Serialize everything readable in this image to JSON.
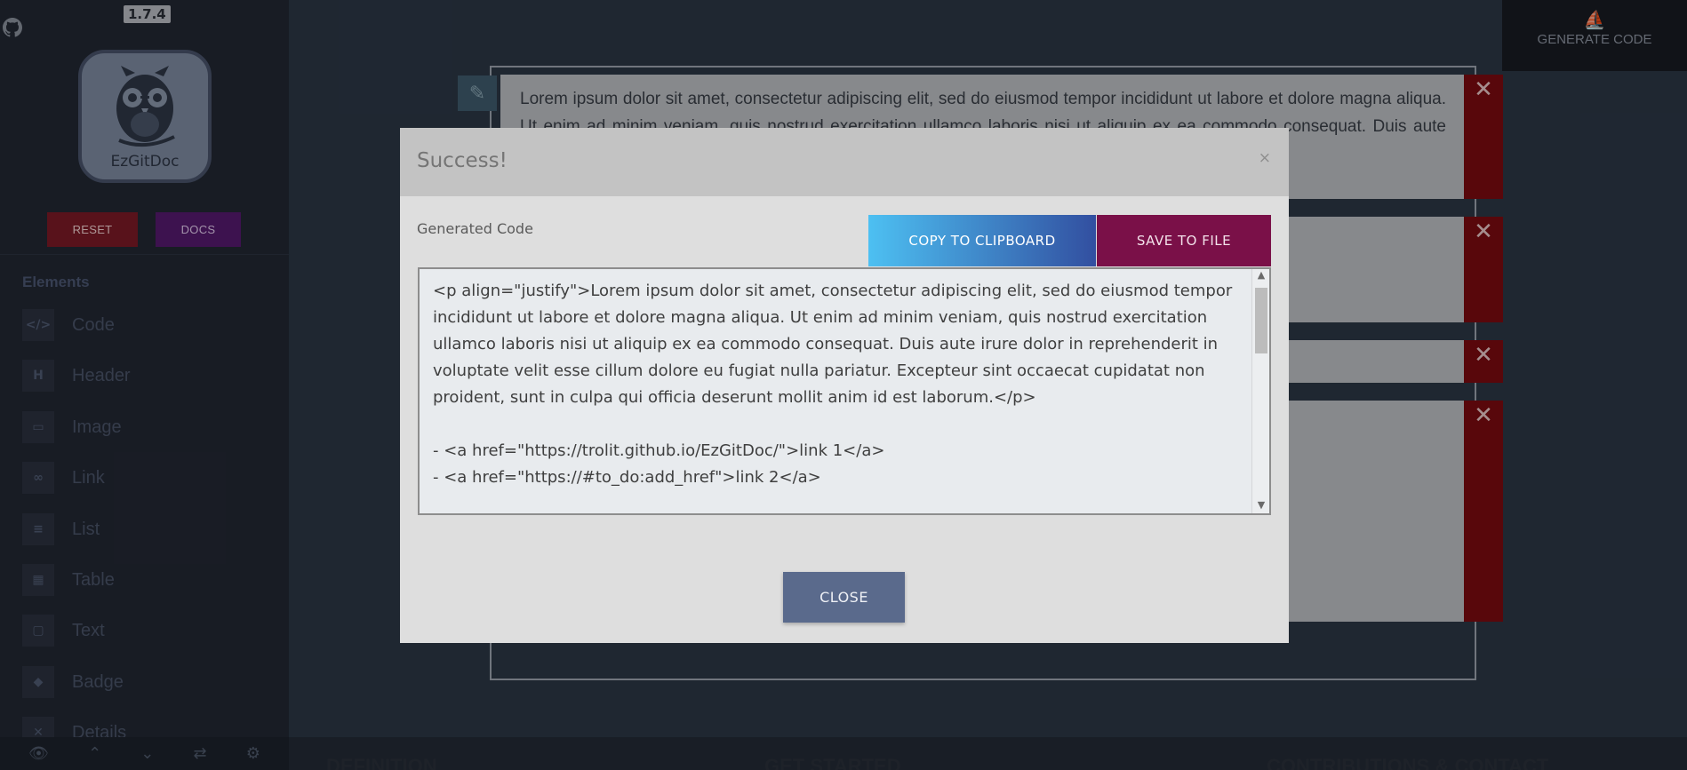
{
  "app": {
    "version": "1.7.4",
    "logo_text": "EzGitDoc"
  },
  "sidebar": {
    "reset_label": "RESET",
    "docs_label": "DOCS",
    "elements_heading": "Elements",
    "items": [
      {
        "label": "Code",
        "icon": "code-icon",
        "glyph": "</>"
      },
      {
        "label": "Header",
        "icon": "header-icon",
        "glyph": "H"
      },
      {
        "label": "Image",
        "icon": "image-icon",
        "glyph": "▭"
      },
      {
        "label": "Link",
        "icon": "link-icon",
        "glyph": "∞"
      },
      {
        "label": "List",
        "icon": "list-icon",
        "glyph": "≡"
      },
      {
        "label": "Table",
        "icon": "table-icon",
        "glyph": "▦"
      },
      {
        "label": "Text",
        "icon": "text-icon",
        "glyph": "▢"
      },
      {
        "label": "Badge",
        "icon": "badge-icon",
        "glyph": "◆"
      },
      {
        "label": "Details",
        "icon": "details-icon",
        "glyph": "✕"
      }
    ],
    "bottom_icons": [
      "eye-icon",
      "double-chevron-up-icon",
      "double-chevron-down-icon",
      "swap-icon",
      "gear-icon"
    ]
  },
  "toolbar": {
    "generate_label": "GENERATE CODE"
  },
  "editor": {
    "block_text": "Lorem ipsum dolor sit amet, consectetur adipiscing elit, sed do eiusmod tempor incididunt ut labore et dolore magna aliqua. Ut enim ad minim veniam, quis nostrud exercitation ullamco laboris nisi ut aliquip ex ea commodo consequat. Duis aute irure dolor in reprehenderit in voluptate velit esse cillum dolore eu fugiat nulla pariatur. Excepteur sint",
    "bottom_labels": [
      "DEFINITION",
      "GET STARTED",
      "CONTRIBUTIONS & CONTACT"
    ]
  },
  "modal": {
    "title": "Success!",
    "close_x": "×",
    "generated_label": "Generated Code",
    "copy_label": "COPY TO CLIPBOARD",
    "save_label": "SAVE TO FILE",
    "code": "<p align=\"justify\">Lorem ipsum dolor sit amet, consectetur adipiscing elit, sed do eiusmod tempor incididunt ut labore et dolore magna aliqua. Ut enim ad minim veniam, quis nostrud exercitation ullamco laboris nisi ut aliquip ex ea commodo consequat. Duis aute irure dolor in reprehenderit in voluptate velit esse cillum dolore eu fugiat nulla pariatur. Excepteur sint occaecat cupidatat non proident, sunt in culpa qui officia deserunt mollit anim id est laborum.</p>\n\n- <a href=\"https://trolit.github.io/EzGitDoc/\">link 1</a>\n- <a href=\"https://#to_do:add_href\">link 2</a>",
    "close_label": "CLOSE"
  },
  "colors": {
    "background": "#2b3645",
    "sidebar": "#222733",
    "reset": "#7a1a26",
    "docs": "#551a6e",
    "delete": "#7a0b10",
    "save": "#7a1048",
    "close": "#5a6a8c"
  }
}
